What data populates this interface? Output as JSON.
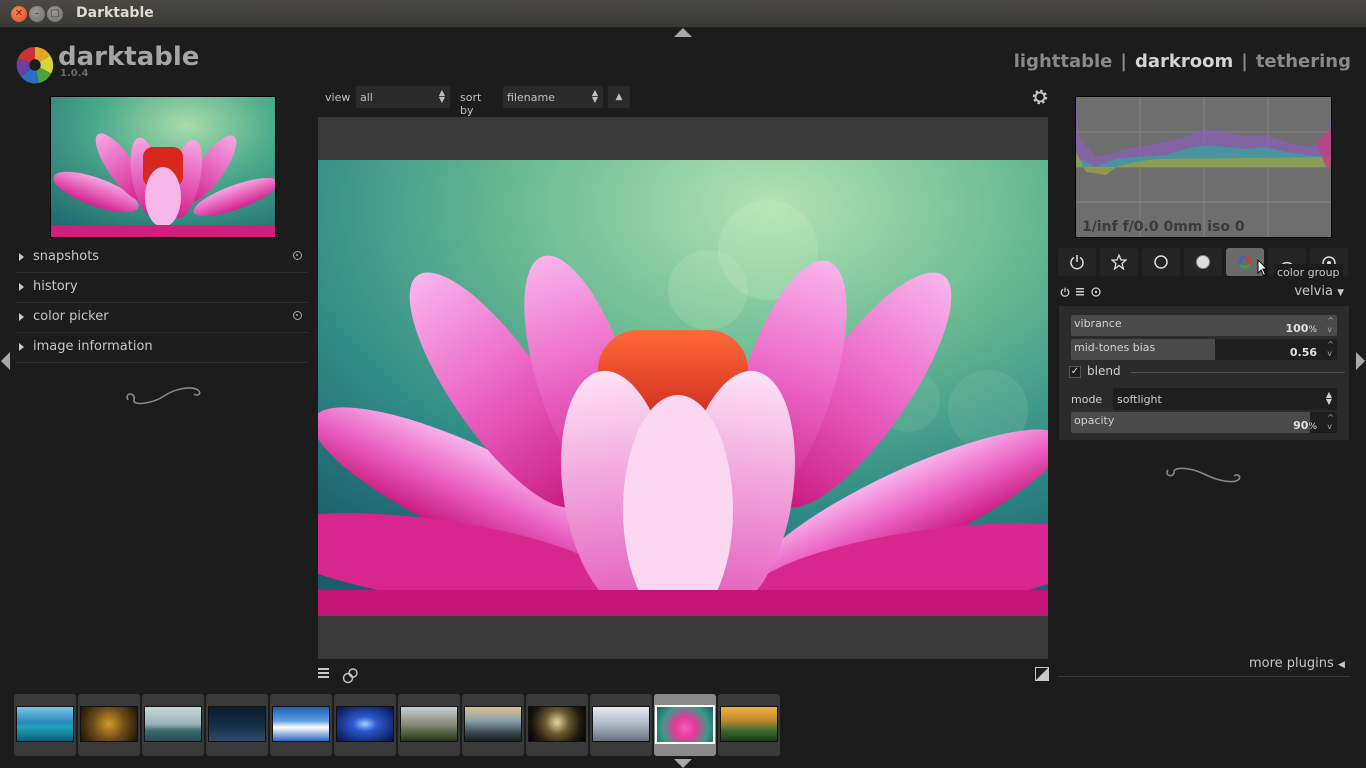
{
  "window": {
    "title": "Darktable"
  },
  "app": {
    "name": "darktable",
    "version": "1.0.4"
  },
  "views": {
    "lighttable": "lighttable",
    "darkroom": "darkroom",
    "tethering": "tethering",
    "separator": "|"
  },
  "left_panel": {
    "items": [
      {
        "label": "snapshots"
      },
      {
        "label": "history"
      },
      {
        "label": "color picker"
      },
      {
        "label": "image information"
      }
    ]
  },
  "filterbar": {
    "view_label": "view",
    "view_value": "all",
    "sort_label": "sort by",
    "sort_value": "filename",
    "sort_dir": "▲"
  },
  "histogram": {
    "exif": "1/inf f/0.0 0mm iso 0"
  },
  "module_groups": {
    "tooltip": "color group",
    "buttons": [
      "power-icon",
      "star-icon",
      "circle-icon",
      "half-circle-icon",
      "color-wheel-icon",
      "curve-icon",
      "effects-icon"
    ],
    "active": "color-wheel-icon"
  },
  "module": {
    "name": "velvia",
    "dropdown": "▼",
    "vibrance": {
      "label": "vibrance",
      "value": "100",
      "unit": "%",
      "level": 1.0
    },
    "midtones": {
      "label": "mid-tones bias",
      "value": "0.56",
      "level": 0.54
    },
    "blend": {
      "label": "blend",
      "checked": "✓"
    },
    "mode": {
      "label": "mode",
      "value": "softlight"
    },
    "opacity": {
      "label": "opacity",
      "value": "90",
      "unit": "%",
      "level": 0.9
    }
  },
  "more_plugins": "more plugins",
  "filmstrip": {
    "count": 12,
    "active_index": 10
  },
  "colors": {
    "background": "#1c1c1c",
    "panel": "#2b2b2b",
    "text": "#c8c8c8",
    "active_view": "#d4d4d4"
  }
}
